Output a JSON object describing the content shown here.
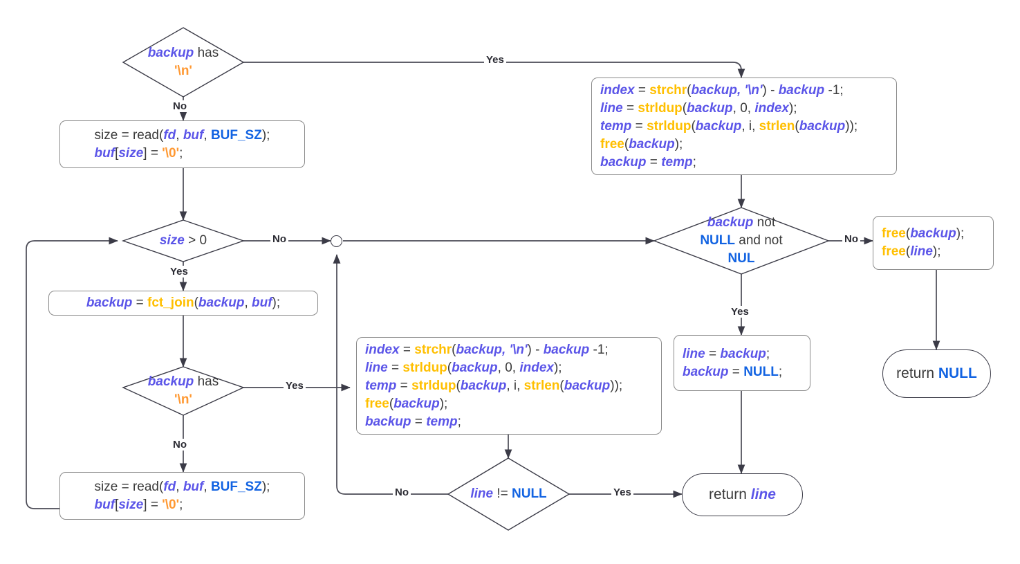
{
  "diagram": {
    "title": "get_next_line flowchart",
    "colors": {
      "variable": "#5b55e8",
      "function": "#ffbf00",
      "keyword": "#1263e2",
      "string": "#ff9933",
      "plain": "#3b3b3b",
      "stroke": "#3b3b47",
      "box_stroke": "#8a8a8a",
      "background": "#ffffff"
    },
    "nodes": {
      "d_backup_has_nl_top": {
        "type": "decision",
        "lines": [
          [
            {
              "t": "backup",
              "c": "v"
            },
            {
              "t": " has",
              "c": "p"
            }
          ],
          [
            {
              "t": "'\\n'",
              "c": "s"
            }
          ]
        ],
        "text": "backup has '\\n'"
      },
      "p_read_top": {
        "type": "process",
        "lines": [
          [
            {
              "t": "size = read(",
              "c": "p"
            },
            {
              "t": "fd",
              "c": "v"
            },
            {
              "t": ", ",
              "c": "p"
            },
            {
              "t": "buf",
              "c": "v"
            },
            {
              "t": ", ",
              "c": "p"
            },
            {
              "t": "BUF_SZ",
              "c": "k"
            },
            {
              "t": ");",
              "c": "p"
            }
          ],
          [
            {
              "t": "buf",
              "c": "v"
            },
            {
              "t": "[",
              "c": "p"
            },
            {
              "t": "size",
              "c": "v"
            },
            {
              "t": "] = ",
              "c": "p"
            },
            {
              "t": "'\\0'",
              "c": "s"
            },
            {
              "t": ";",
              "c": "p"
            }
          ]
        ],
        "text": "size = read(fd, buf, BUF_SZ); buf[size] = '\\0';"
      },
      "p_split_top": {
        "type": "process",
        "lines": [
          [
            {
              "t": "index",
              "c": "v"
            },
            {
              "t": " = ",
              "c": "p"
            },
            {
              "t": "strchr",
              "c": "f"
            },
            {
              "t": "(",
              "c": "p"
            },
            {
              "t": "backup, '\\n'",
              "c": "v"
            },
            {
              "t": ") - ",
              "c": "p"
            },
            {
              "t": "backup",
              "c": "v"
            },
            {
              "t": " -1;",
              "c": "p"
            }
          ],
          [
            {
              "t": "line",
              "c": "v"
            },
            {
              "t": " = ",
              "c": "p"
            },
            {
              "t": "strldup",
              "c": "f"
            },
            {
              "t": "(",
              "c": "p"
            },
            {
              "t": "backup",
              "c": "v"
            },
            {
              "t": ", 0, ",
              "c": "p"
            },
            {
              "t": "index",
              "c": "v"
            },
            {
              "t": ");",
              "c": "p"
            }
          ],
          [
            {
              "t": "temp",
              "c": "v"
            },
            {
              "t": " = ",
              "c": "p"
            },
            {
              "t": "strldup",
              "c": "f"
            },
            {
              "t": "(",
              "c": "p"
            },
            {
              "t": "backup",
              "c": "v"
            },
            {
              "t": ", i, ",
              "c": "p"
            },
            {
              "t": "strlen",
              "c": "f"
            },
            {
              "t": "(",
              "c": "p"
            },
            {
              "t": "backup",
              "c": "v"
            },
            {
              "t": "));",
              "c": "p"
            }
          ],
          [
            {
              "t": "free",
              "c": "f"
            },
            {
              "t": "(",
              "c": "p"
            },
            {
              "t": "backup",
              "c": "v"
            },
            {
              "t": ");",
              "c": "p"
            }
          ],
          [
            {
              "t": "backup",
              "c": "v"
            },
            {
              "t": " = ",
              "c": "p"
            },
            {
              "t": "temp",
              "c": "v"
            },
            {
              "t": ";",
              "c": "p"
            }
          ]
        ],
        "text": "index = strchr(backup, '\\n') - backup -1; line = strldup(backup, 0, index); temp = strldup(backup, i, strlen(backup)); free(backup); backup = temp;"
      },
      "d_size_gt_0": {
        "type": "decision",
        "lines": [
          [
            {
              "t": "size",
              "c": "v"
            },
            {
              "t": " > 0",
              "c": "p"
            }
          ]
        ],
        "text": "size > 0"
      },
      "p_fct_join": {
        "type": "process",
        "lines": [
          [
            {
              "t": "backup",
              "c": "v"
            },
            {
              "t": " = ",
              "c": "p"
            },
            {
              "t": "fct_join",
              "c": "f"
            },
            {
              "t": "(",
              "c": "p"
            },
            {
              "t": "backup",
              "c": "v"
            },
            {
              "t": ", ",
              "c": "p"
            },
            {
              "t": "buf",
              "c": "v"
            },
            {
              "t": ");",
              "c": "p"
            }
          ]
        ],
        "text": "backup = fct_join(backup, buf);"
      },
      "d_backup_has_nl_bottom": {
        "type": "decision",
        "lines": [
          [
            {
              "t": "backup",
              "c": "v"
            },
            {
              "t": " has",
              "c": "p"
            }
          ],
          [
            {
              "t": "'\\n'",
              "c": "s"
            }
          ]
        ],
        "text": "backup has '\\n'"
      },
      "p_read_bottom": {
        "type": "process",
        "lines": [
          [
            {
              "t": "size = read(",
              "c": "p"
            },
            {
              "t": "fd",
              "c": "v"
            },
            {
              "t": ", ",
              "c": "p"
            },
            {
              "t": "buf",
              "c": "v"
            },
            {
              "t": ", ",
              "c": "p"
            },
            {
              "t": "BUF_SZ",
              "c": "k"
            },
            {
              "t": ");",
              "c": "p"
            }
          ],
          [
            {
              "t": "buf",
              "c": "v"
            },
            {
              "t": "[",
              "c": "p"
            },
            {
              "t": "size",
              "c": "v"
            },
            {
              "t": "] = ",
              "c": "p"
            },
            {
              "t": "'\\0'",
              "c": "s"
            },
            {
              "t": ";",
              "c": "p"
            }
          ]
        ],
        "text": "size = read(fd, buf, BUF_SZ); buf[size] = '\\0';"
      },
      "p_split_mid": {
        "type": "process",
        "lines": [
          [
            {
              "t": "index",
              "c": "v"
            },
            {
              "t": " = ",
              "c": "p"
            },
            {
              "t": "strchr",
              "c": "f"
            },
            {
              "t": "(",
              "c": "p"
            },
            {
              "t": "backup, '\\n'",
              "c": "v"
            },
            {
              "t": ") - ",
              "c": "p"
            },
            {
              "t": "backup",
              "c": "v"
            },
            {
              "t": " -1;",
              "c": "p"
            }
          ],
          [
            {
              "t": "line",
              "c": "v"
            },
            {
              "t": " = ",
              "c": "p"
            },
            {
              "t": "strldup",
              "c": "f"
            },
            {
              "t": "(",
              "c": "p"
            },
            {
              "t": "backup",
              "c": "v"
            },
            {
              "t": ", 0, ",
              "c": "p"
            },
            {
              "t": "index",
              "c": "v"
            },
            {
              "t": ");",
              "c": "p"
            }
          ],
          [
            {
              "t": "temp",
              "c": "v"
            },
            {
              "t": " = ",
              "c": "p"
            },
            {
              "t": "strldup",
              "c": "f"
            },
            {
              "t": "(",
              "c": "p"
            },
            {
              "t": "backup",
              "c": "v"
            },
            {
              "t": ", i, ",
              "c": "p"
            },
            {
              "t": "strlen",
              "c": "f"
            },
            {
              "t": "(",
              "c": "p"
            },
            {
              "t": "backup",
              "c": "v"
            },
            {
              "t": "));",
              "c": "p"
            }
          ],
          [
            {
              "t": "free",
              "c": "f"
            },
            {
              "t": "(",
              "c": "p"
            },
            {
              "t": "backup",
              "c": "v"
            },
            {
              "t": ");",
              "c": "p"
            }
          ],
          [
            {
              "t": "backup",
              "c": "v"
            },
            {
              "t": " = ",
              "c": "p"
            },
            {
              "t": "temp",
              "c": "v"
            },
            {
              "t": ";",
              "c": "p"
            }
          ]
        ],
        "text": "index = strchr(backup, '\\n') - backup -1; line = strldup(backup, 0, index); temp = strldup(backup, i, strlen(backup)); free(backup); backup = temp;"
      },
      "d_line_not_null": {
        "type": "decision",
        "lines": [
          [
            {
              "t": "line",
              "c": "v"
            },
            {
              "t": " != ",
              "c": "p"
            },
            {
              "t": "NULL",
              "c": "k"
            }
          ]
        ],
        "text": "line != NULL"
      },
      "d_backup_not_null": {
        "type": "decision",
        "lines": [
          [
            {
              "t": "backup",
              "c": "v"
            },
            {
              "t": " not",
              "c": "p"
            }
          ],
          [
            {
              "t": "NULL",
              "c": "k"
            },
            {
              "t": " and not",
              "c": "p"
            }
          ],
          [
            {
              "t": "NUL",
              "c": "k"
            }
          ]
        ],
        "text": "backup not NULL and not NUL"
      },
      "p_free_both": {
        "type": "process",
        "lines": [
          [
            {
              "t": "free",
              "c": "f"
            },
            {
              "t": "(",
              "c": "p"
            },
            {
              "t": "backup",
              "c": "v"
            },
            {
              "t": ");",
              "c": "p"
            }
          ],
          [
            {
              "t": "free",
              "c": "f"
            },
            {
              "t": "(",
              "c": "p"
            },
            {
              "t": "line",
              "c": "v"
            },
            {
              "t": ");",
              "c": "p"
            }
          ]
        ],
        "text": "free(backup); free(line);"
      },
      "p_line_backup": {
        "type": "process",
        "lines": [
          [
            {
              "t": "line",
              "c": "v"
            },
            {
              "t": " = ",
              "c": "p"
            },
            {
              "t": "backup",
              "c": "v"
            },
            {
              "t": ";",
              "c": "p"
            }
          ],
          [
            {
              "t": "backup",
              "c": "v"
            },
            {
              "t": " = ",
              "c": "p"
            },
            {
              "t": "NULL",
              "c": "k"
            },
            {
              "t": ";",
              "c": "p"
            }
          ]
        ],
        "text": "line = backup; backup = NULL;"
      },
      "t_return_null": {
        "type": "terminal",
        "lines": [
          [
            {
              "t": "return ",
              "c": "p"
            },
            {
              "t": "NULL",
              "c": "k"
            }
          ]
        ],
        "text": "return NULL"
      },
      "t_return_line": {
        "type": "terminal",
        "lines": [
          [
            {
              "t": "return ",
              "c": "p"
            },
            {
              "t": "line",
              "c": "v"
            }
          ]
        ],
        "text": "return line"
      },
      "junction": {
        "type": "junction",
        "text": ""
      }
    },
    "edge_labels": {
      "yes_top": "Yes",
      "no_top": "No",
      "no_size": "No",
      "yes_size": "Yes",
      "yes_nl_bottom": "Yes",
      "no_nl_bottom": "No",
      "no_line_null": "No",
      "yes_line_null": "Yes",
      "no_backup_null": "No",
      "yes_backup_null": "Yes"
    }
  }
}
